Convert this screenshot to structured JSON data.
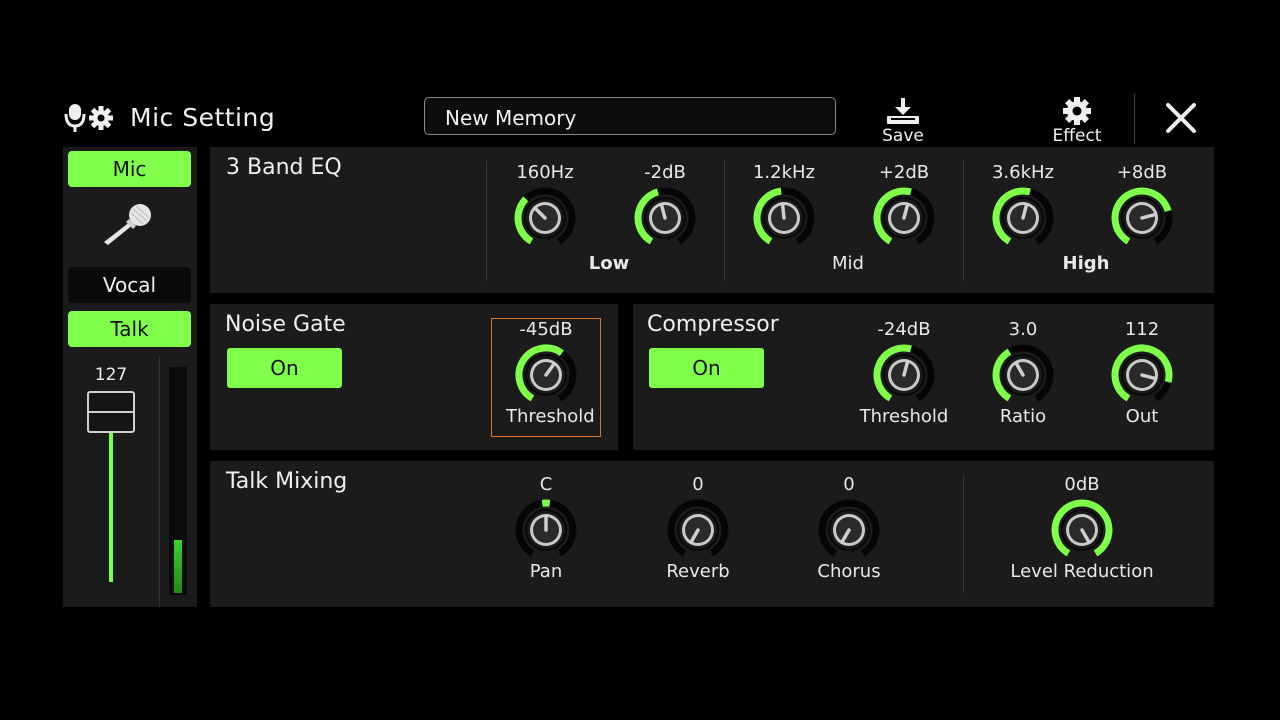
{
  "header": {
    "title": "Mic Setting",
    "memory_name": "New Memory",
    "save_label": "Save",
    "effect_label": "Effect",
    "icons": {
      "title": "mic-gear-icon",
      "save": "save-icon",
      "effect": "gear-icon",
      "close": "close-icon"
    }
  },
  "sidebar": {
    "tabs": [
      {
        "label": "Mic",
        "active": true
      },
      {
        "label": "Vocal",
        "active": false
      },
      {
        "label": "Talk",
        "active": true
      }
    ],
    "fader_value": "127",
    "fader_level": 1.0,
    "meter_level": 0.23
  },
  "eq": {
    "title": "3 Band EQ",
    "bands": [
      {
        "name": "Low",
        "bold": true,
        "freq": "160Hz",
        "gain": "-2dB"
      },
      {
        "name": "Mid",
        "bold": false,
        "freq": "1.2kHz",
        "gain": "+2dB"
      },
      {
        "name": "High",
        "bold": true,
        "freq": "3.6kHz",
        "gain": "+8dB"
      }
    ]
  },
  "noise_gate": {
    "title": "Noise Gate",
    "state": "On",
    "threshold": {
      "value": "-45dB",
      "label": "Threshold"
    }
  },
  "compressor": {
    "title": "Compressor",
    "state": "On",
    "knobs": [
      {
        "value": "-24dB",
        "label": "Threshold"
      },
      {
        "value": "3.0",
        "label": "Ratio"
      },
      {
        "value": "112",
        "label": "Out"
      }
    ]
  },
  "talk_mixing": {
    "title": "Talk Mixing",
    "knobs": [
      {
        "value": "C",
        "label": "Pan"
      },
      {
        "value": "0",
        "label": "Reverb"
      },
      {
        "value": "0",
        "label": "Chorus"
      },
      {
        "value": "0dB",
        "label": "Level Reduction"
      }
    ]
  },
  "colors": {
    "accent": "#7fff49",
    "panel": "#1b1b1b",
    "background": "#000000",
    "focus": "#d9762b"
  },
  "knob_levels": {
    "eq_low_freq": 0.35,
    "eq_low_gain": 0.45,
    "eq_mid_freq": 0.48,
    "eq_mid_gain": 0.55,
    "eq_high_freq": 0.55,
    "eq_high_gain": 0.75,
    "ng_threshold": 0.62,
    "comp_threshold": 0.55,
    "comp_ratio": 0.4,
    "comp_out": 0.85,
    "pan": 0.5,
    "reverb": 0.0,
    "chorus": 0.0,
    "level_reduction": 1.0
  }
}
